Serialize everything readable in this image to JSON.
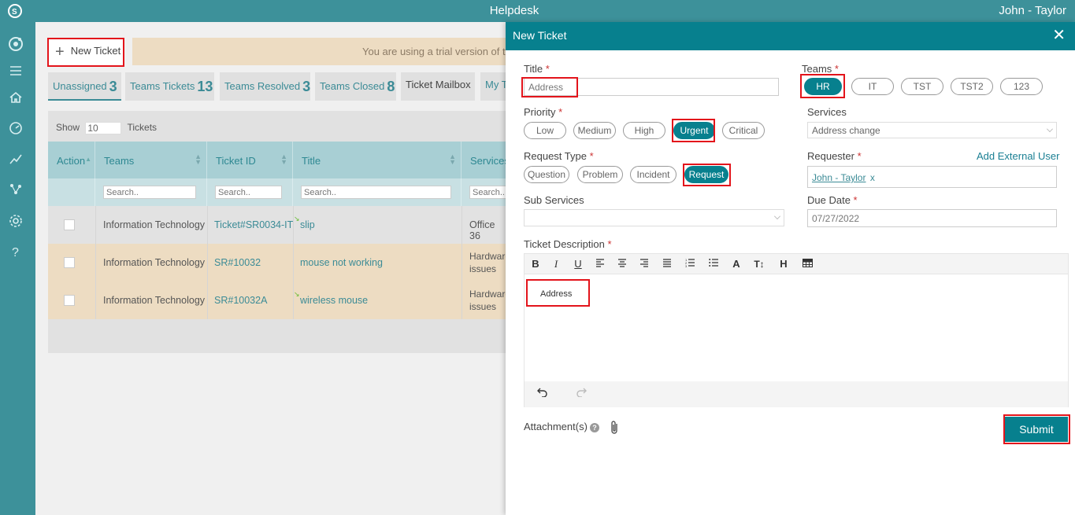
{
  "app": {
    "title": "Helpdesk",
    "user": "John - Taylor"
  },
  "nav": [
    "logo-icon",
    "dashboard-icon",
    "menu-icon",
    "home-icon",
    "speed-icon",
    "chart-icon",
    "network-icon",
    "gear-icon",
    "help-icon"
  ],
  "toolbar": {
    "new_ticket": "New Ticket",
    "trial": "You are using a trial version of t"
  },
  "tabs": [
    {
      "label": "Unassigned",
      "count": "3"
    },
    {
      "label": "Teams Tickets",
      "count": "13"
    },
    {
      "label": "Teams Resolved",
      "count": "3"
    },
    {
      "label": "Teams Closed",
      "count": "8"
    },
    {
      "label": "Ticket Mailbox",
      "count": ""
    },
    {
      "label": "My T",
      "count": ""
    }
  ],
  "list": {
    "show_label": "Show",
    "show_value": "10",
    "tickets_label": "Tickets",
    "columns": [
      "Action",
      "Teams",
      "Ticket ID",
      "Title",
      "Services"
    ],
    "search_placeholder": "Search..",
    "rows": [
      {
        "team": "Information Technology",
        "id": "Ticket#SR0034-IT",
        "title": "slip",
        "service1": "Office 36",
        "service2": ""
      },
      {
        "team": "Information Technology",
        "id": "SR#10032",
        "title": "mouse not working",
        "service1": "Hardware",
        "service2": "issues"
      },
      {
        "team": "Information Technology",
        "id": "SR#10032A",
        "title": "wireless mouse",
        "service1": "Hardware",
        "service2": "issues"
      }
    ]
  },
  "modal": {
    "title": "New Ticket",
    "close": "✕",
    "title_label": "Title",
    "title_value": "Address",
    "teams_label": "Teams",
    "teams": [
      "HR",
      "IT",
      "TST",
      "TST2",
      "123"
    ],
    "priority_label": "Priority",
    "priorities": [
      "Low",
      "Medium",
      "High",
      "Urgent",
      "Critical"
    ],
    "services_label": "Services",
    "services_value": "Address change",
    "request_type_label": "Request Type",
    "request_types": [
      "Question",
      "Problem",
      "Incident",
      "Request"
    ],
    "requester_label": "Requester",
    "add_external": "Add External User",
    "requester_value": "John - Taylor",
    "requester_remove": "x",
    "sub_services_label": "Sub Services",
    "due_date_label": "Due Date",
    "due_date_value": "07/27/2022",
    "description_label": "Ticket Description",
    "description_value": "Address",
    "attachments_label": "Attachment(s)",
    "submit": "Submit",
    "required_mark": "*"
  },
  "colors": {
    "accent": "#07808e",
    "topbar": "#3d919a",
    "highlight": "#e3141b"
  }
}
